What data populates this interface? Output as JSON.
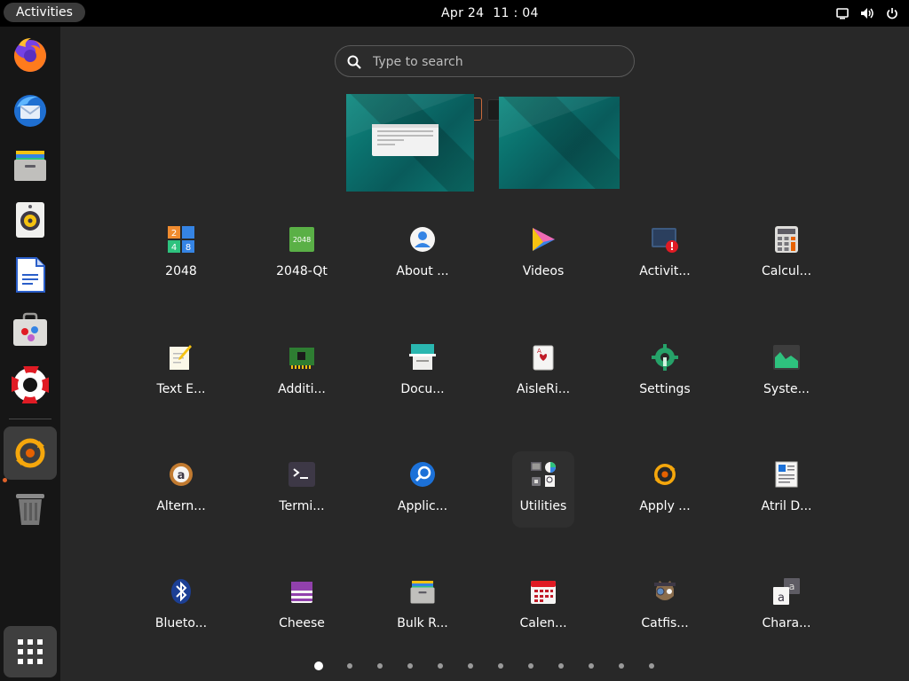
{
  "topbar": {
    "activities_label": "Activities",
    "date": "Apr 24",
    "time_hour": "11",
    "time_sep": ":",
    "time_min": "04",
    "tray_icons": [
      "screen-icon",
      "volume-icon",
      "power-icon"
    ]
  },
  "dock": {
    "items": [
      {
        "name": "firefox",
        "icon": "firefox-icon"
      },
      {
        "name": "thunderbird",
        "icon": "thunderbird-icon"
      },
      {
        "name": "files",
        "icon": "files-icon"
      },
      {
        "name": "rhythmbox",
        "icon": "speaker-icon"
      },
      {
        "name": "writer",
        "icon": "document-icon"
      },
      {
        "name": "software",
        "icon": "software-bag-icon"
      },
      {
        "name": "help",
        "icon": "lifebuoy-icon"
      },
      {
        "name": "apply-updates",
        "icon": "update-icon"
      },
      {
        "name": "trash",
        "icon": "trash-icon"
      }
    ]
  },
  "search": {
    "placeholder": "Type to search"
  },
  "apps": [
    {
      "label": "2048",
      "icon": "2048-icon"
    },
    {
      "label": "2048-Qt",
      "icon": "2048-qt-icon"
    },
    {
      "label": "About ...",
      "icon": "about-icon"
    },
    {
      "label": "Videos",
      "icon": "videos-icon"
    },
    {
      "label": "Activit...",
      "icon": "activity-monitor-icon"
    },
    {
      "label": "Calcul...",
      "icon": "calculator-icon"
    },
    {
      "label": "Text E...",
      "icon": "text-editor-icon"
    },
    {
      "label": "Additi...",
      "icon": "additional-drivers-icon"
    },
    {
      "label": "Docu...",
      "icon": "document-scanner-icon"
    },
    {
      "label": "AisleRi...",
      "icon": "aisleriot-icon"
    },
    {
      "label": "Settings",
      "icon": "settings-icon"
    },
    {
      "label": "Syste...",
      "icon": "system-monitor-icon"
    },
    {
      "label": "Altern...",
      "icon": "alternatives-icon"
    },
    {
      "label": "Termi...",
      "icon": "terminal-icon"
    },
    {
      "label": "Applic...",
      "icon": "app-finder-icon"
    },
    {
      "label": "Utilities",
      "icon": "utilities-folder-icon"
    },
    {
      "label": "Apply ...",
      "icon": "apply-updates-icon"
    },
    {
      "label": "Atril D...",
      "icon": "atril-icon"
    },
    {
      "label": "Blueto...",
      "icon": "bluetooth-icon"
    },
    {
      "label": "Cheese",
      "icon": "cheese-icon"
    },
    {
      "label": "Bulk R...",
      "icon": "bulk-rename-icon"
    },
    {
      "label": "Calen...",
      "icon": "calendar-icon"
    },
    {
      "label": "Catfis...",
      "icon": "catfish-icon"
    },
    {
      "label": "Chara...",
      "icon": "character-map-icon"
    }
  ],
  "pages": {
    "count": 12,
    "current": 1
  },
  "colors": {
    "accent": "#e0622a",
    "background": "#282828",
    "panel": "#000000"
  }
}
